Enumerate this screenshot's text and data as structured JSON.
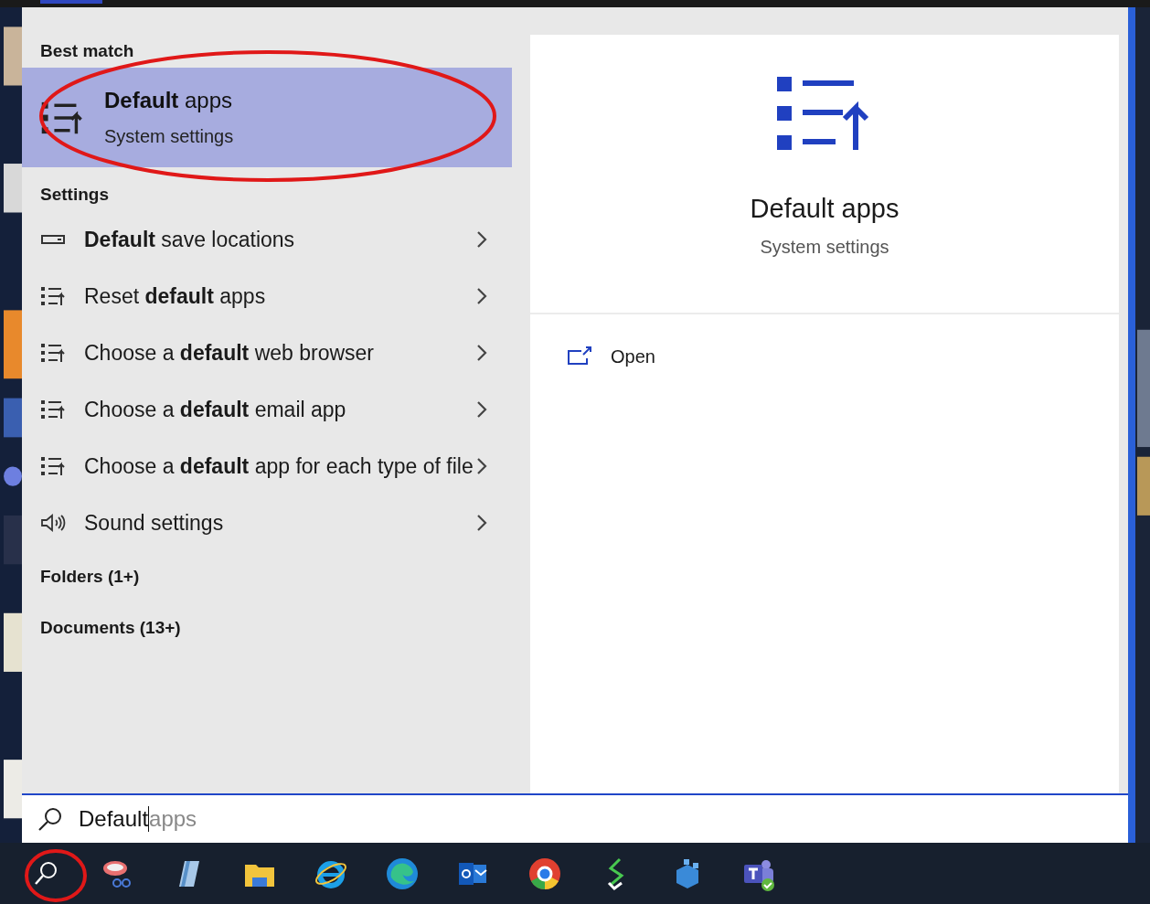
{
  "best_match": {
    "heading": "Best match",
    "title": "**Default** apps",
    "subtitle": "System settings",
    "selected": true
  },
  "settings": {
    "heading": "Settings",
    "items": [
      {
        "kind": "drive",
        "label": "**Default** save locations"
      },
      {
        "kind": "list",
        "label": "Reset **default** apps"
      },
      {
        "kind": "list",
        "label": "Choose a **default** web browser"
      },
      {
        "kind": "list",
        "label": "Choose a **default** email app"
      },
      {
        "kind": "list",
        "label": "Choose a **default** app for each type of file"
      },
      {
        "kind": "sound",
        "label": "Sound settings"
      }
    ]
  },
  "groups": [
    "Folders (1+)",
    "Documents (13+)"
  ],
  "preview": {
    "title": "Default apps",
    "subtitle": "System settings",
    "actions": [
      "Open"
    ]
  },
  "search": {
    "value": "Default",
    "suggestion": "apps"
  }
}
